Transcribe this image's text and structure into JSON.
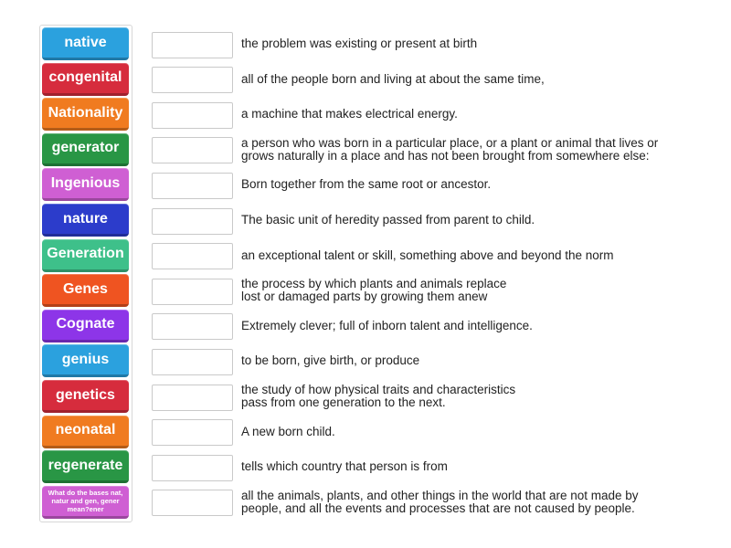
{
  "tiles": [
    {
      "label": "native",
      "color": "#2ba1de"
    },
    {
      "label": "congenital",
      "color": "#d62c3d"
    },
    {
      "label": "Nationality",
      "color": "#f07b20"
    },
    {
      "label": "generator",
      "color": "#299645"
    },
    {
      "label": "Ingenious",
      "color": "#cf5fd3"
    },
    {
      "label": "nature",
      "color": "#2c3ccb"
    },
    {
      "label": "Generation",
      "color": "#3ec08a"
    },
    {
      "label": "Genes",
      "color": "#ef5421"
    },
    {
      "label": "Cognate",
      "color": "#8d35e8"
    },
    {
      "label": "genius",
      "color": "#2ba1de"
    },
    {
      "label": "genetics",
      "color": "#d62c3d"
    },
    {
      "label": "neonatal",
      "color": "#f07b20"
    },
    {
      "label": "regenerate",
      "color": "#299645"
    },
    {
      "label": "What do the bases nat, natur and gen, gener mean?ener",
      "color": "#cf5fd3"
    }
  ],
  "definitions": [
    "the problem was existing or present at birth",
    "all of the people born and living at about the same time,",
    "a machine that makes electrical energy.",
    "a person who was born in a particular place, or a plant or animal that lives or\ngrows naturally in a place and has not been brought from somewhere else:",
    "Born together from the same root or ancestor.",
    "The basic unit of heredity passed from parent to child.",
    "an exceptional talent or skill, something above and beyond the norm",
    "the process by which plants and animals replace\nlost or damaged parts by growing them anew",
    "Extremely clever; full of inborn talent and intelligence.",
    "to be born, give birth, or produce",
    "the study of how physical traits and characteristics\npass from one generation to the next.",
    "A new born child.",
    "tells which country that person is from",
    "all the animals, plants, and other things in the world that are not made by\npeople, and all the events and processes that are not caused by people."
  ]
}
